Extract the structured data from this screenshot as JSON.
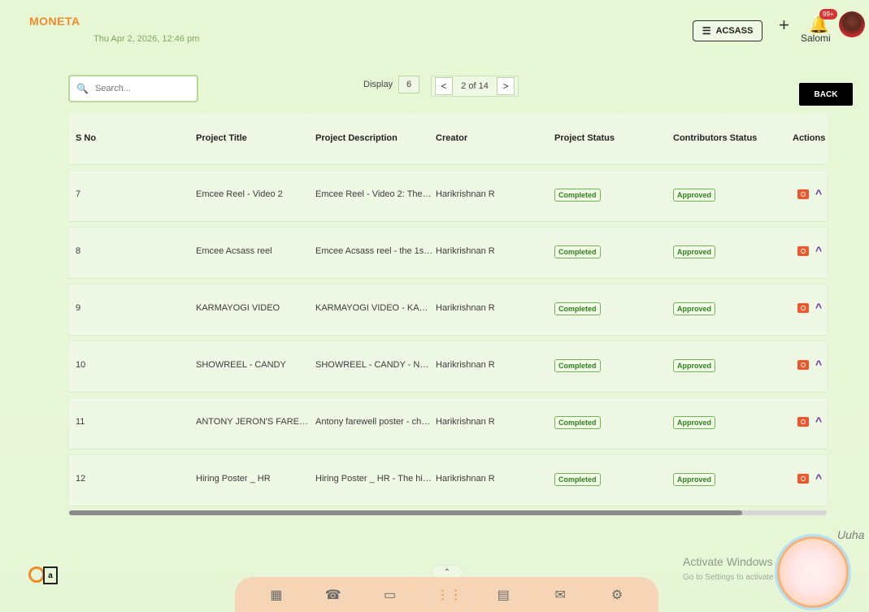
{
  "app": {
    "brand": "MONETA",
    "datetime": "Thu Apr 2, 2026, 12:46 pm"
  },
  "header": {
    "org_button": "ACSASS",
    "notifications_badge": "99+",
    "user_name": "Salomi"
  },
  "toolbar": {
    "search_placeholder": "Search...",
    "display_label": "Display",
    "display_value": "6",
    "page_text": "2 of 14",
    "back_label": "BACK"
  },
  "table": {
    "headers": [
      "S No",
      "Project Title",
      "Project Description",
      "Creator",
      "Project Status",
      "Contributors Status",
      "Actions"
    ],
    "rows": [
      {
        "sno": "7",
        "title": "Emcee Reel - Video 2",
        "description": "Emcee Reel - Video 2: The 2…",
        "creator": "Harikrishnan R",
        "project_status": "Completed",
        "contributors_status": "Approved"
      },
      {
        "sno": "8",
        "title": "Emcee Acsass reel",
        "description": "Emcee Acsass reel - the 1st r…",
        "creator": "Harikrishnan R",
        "project_status": "Completed",
        "contributors_status": "Approved"
      },
      {
        "sno": "9",
        "title": "KARMAYOGI VIDEO",
        "description": "KARMAYOGI VIDEO - KARMA…",
        "creator": "Harikrishnan R",
        "project_status": "Completed",
        "contributors_status": "Approved"
      },
      {
        "sno": "10",
        "title": "SHOWREEL - CANDY",
        "description": "SHOWREEL - CANDY - Nearly…",
        "creator": "Harikrishnan R",
        "project_status": "Completed",
        "contributors_status": "Approved"
      },
      {
        "sno": "11",
        "title": "ANTONY JERON'S FAREWEL…",
        "description": "Antony farewell poster - cha…",
        "creator": "Harikrishnan R",
        "project_status": "Completed",
        "contributors_status": "Approved"
      },
      {
        "sno": "12",
        "title": "Hiring Poster _ HR",
        "description": "Hiring Poster _ HR - The hiri…",
        "creator": "Harikrishnan R",
        "project_status": "Completed",
        "contributors_status": "Approved"
      }
    ]
  },
  "overlay": {
    "activate_windows_title": "Activate Windows",
    "activate_windows_sub": "Go to Settings to activate Windows."
  },
  "dock": {
    "handle_icon": "chevron-up",
    "icons": [
      "dashboard-icon",
      "phone-icon",
      "video-icon",
      "apps-icon",
      "document-icon",
      "megaphone-icon",
      "settings-icon"
    ]
  }
}
